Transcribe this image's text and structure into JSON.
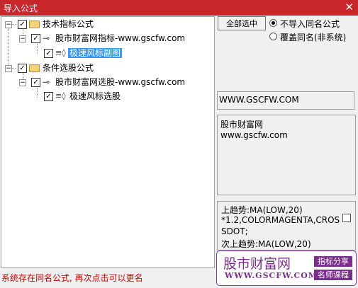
{
  "window": {
    "title": "导入公式",
    "close_glyph": "✕"
  },
  "tree": {
    "nodes": [
      {
        "label": "技术指标公式",
        "expander": "−",
        "check": "✓"
      },
      {
        "label": "股市财富网指标-www.gscfw.com",
        "expander": "−",
        "check": "✓"
      },
      {
        "label": "极速风标副图",
        "check": "✓",
        "selected": true
      },
      {
        "label": "条件选股公式",
        "expander": "−",
        "check": "✓"
      },
      {
        "label": "股市财富网选股-www.gscfw.com",
        "expander": "−",
        "check": "✓"
      },
      {
        "label": "极速风标选股",
        "check": "✓"
      }
    ]
  },
  "options": {
    "select_all_label": "全部选中",
    "radio_skip_label": "不导入同名公式",
    "radio_overwrite_label": "覆盖同名(非系统)",
    "selected_radio": "skip"
  },
  "url_field": {
    "value": "WWW.GSCFW.COM"
  },
  "description": {
    "line1": "股市财富网",
    "line2": "www.gscfw.com"
  },
  "code_preview": {
    "lines": [
      "上趋势:MA(LOW,20)",
      "*1.2,COLORMAGENTA,CROS",
      "SDOT;",
      "次上趋势:MA(LOW,20)"
    ]
  },
  "watermark": {
    "name": "股市财富网",
    "url": "WWW.GSCFW.COM",
    "tag1": "指标分享",
    "tag2": "名师课程",
    "color": "#7b2e8f"
  },
  "status": {
    "text": "系统存在同名公式, 再次点击可以更名"
  },
  "colors": {
    "titlebar": "#c8262b",
    "selection": "#3399ff",
    "status": "#d00000"
  }
}
